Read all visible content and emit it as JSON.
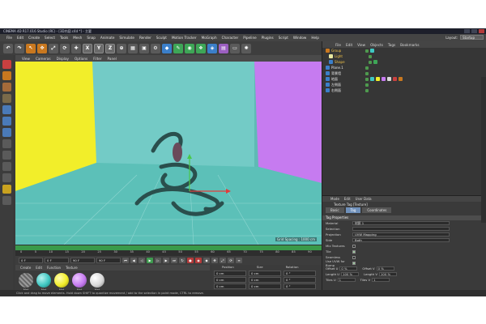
{
  "window": {
    "title": "CINEMA 4D R17.016 Studio (RC) - [3D内容.c4d *] - 主要"
  },
  "menu": [
    "File",
    "Edit",
    "Create",
    "Select",
    "Tools",
    "Mesh",
    "Snap",
    "Animate",
    "Simulate",
    "Render",
    "Sculpt",
    "Motion Tracker",
    "MoGraph",
    "Character",
    "Pipeline",
    "Plugins",
    "Script",
    "Window",
    "Help"
  ],
  "layout": {
    "label": "Layout:",
    "value": "Startup"
  },
  "toolbar_letters": [
    "X",
    "Y",
    "Z"
  ],
  "viewport": {
    "menu": [
      "View",
      "Cameras",
      "Display",
      "Options",
      "Filter",
      "Panel"
    ],
    "footer": "Grid Spacing : 1000 cm",
    "colors": {
      "floor": "#5cc0b8",
      "wall": "#73cbc6",
      "left_wall": "#f2ee2a",
      "right_wall": "#c67bf0"
    }
  },
  "timeline": {
    "ticks": [
      "0",
      "5",
      "10",
      "15",
      "20",
      "25",
      "30",
      "35",
      "40",
      "45",
      "50",
      "55",
      "60",
      "65",
      "70",
      "75",
      "80",
      "85",
      "90"
    ],
    "start_field": "0 F",
    "start_field2": "0 F",
    "end_field": "90 F",
    "end_field2": "90 F"
  },
  "material_manager": {
    "menu": [
      "Create",
      "Edit",
      "Function",
      "Texture"
    ],
    "materials": [
      {
        "label": "Mat",
        "color": "#8a8a8a"
      },
      {
        "label": "Mat",
        "color": "#3fc7c2"
      },
      {
        "label": "Mat",
        "color": "#f2ee2a"
      },
      {
        "label": "Mat",
        "color": "#c67bf0"
      },
      {
        "label": "Mat",
        "color": "#d9d9d9"
      }
    ]
  },
  "coordinates": {
    "headers": [
      "Position",
      "Size",
      "Rotation"
    ],
    "rows": [
      {
        "pos": "0 cm",
        "size": "0 cm",
        "rot": "0 °"
      },
      {
        "pos": "0 cm",
        "size": "0 cm",
        "rot": "0 °"
      },
      {
        "pos": "0 cm",
        "size": "0 cm",
        "rot": "0 °"
      }
    ],
    "mode_button": "Object (Rel)",
    "size_button": "Size",
    "apply_button": "Apply"
  },
  "status": "Click and drag to move elements. Hold down SHIFT to quantize movement / add to the selection in point mode, CTRL to remove.",
  "object_manager": {
    "menu": [
      "File",
      "Edit",
      "View",
      "Objects",
      "Tags",
      "Bookmarks"
    ],
    "objects": [
      {
        "name": "Group",
        "color": "#f2c349"
      },
      {
        "name": "Light",
        "color": "#e0e0e0"
      },
      {
        "name": "Shape",
        "color": "#e0e0e0"
      },
      {
        "name": "Plane.1",
        "color": "#e0e0e0"
      },
      {
        "name": "背景墙",
        "color": "#e0e0e0"
      },
      {
        "name": "地面",
        "color": "#e0e0e0"
      },
      {
        "name": "左侧面",
        "color": "#e0e0e0"
      },
      {
        "name": "右侧面",
        "color": "#e0e0e0"
      }
    ]
  },
  "attributes": {
    "menu": [
      "Mode",
      "Edit",
      "User Data"
    ],
    "title": "Texture Tag [Texture]",
    "tabs": [
      "Basic",
      "Tag",
      "Coordinates"
    ],
    "active_tab": "Tag",
    "section": "Tag Properties",
    "props": [
      {
        "label": "Material",
        "value": "材质 1"
      },
      {
        "label": "Selection",
        "value": ""
      },
      {
        "label": "Projection",
        "value": "UVW Mapping"
      },
      {
        "label": "Side",
        "value": "Both"
      }
    ],
    "checks": [
      {
        "label": "Mix Textures",
        "on": false
      },
      {
        "label": "Tile",
        "on": true
      },
      {
        "label": "Seamless",
        "on": false
      },
      {
        "label": "Use UVW for Bump",
        "on": true
      }
    ],
    "offsets": [
      {
        "a_label": "Offset U",
        "a_val": "0 %",
        "b_label": "Offset V",
        "b_val": "0 %"
      },
      {
        "a_label": "Length U",
        "a_val": "100 %",
        "b_label": "Length V",
        "b_val": "100 %"
      },
      {
        "a_label": "Tiles U",
        "a_val": "1",
        "b_label": "Tiles V",
        "b_val": "1"
      }
    ]
  }
}
